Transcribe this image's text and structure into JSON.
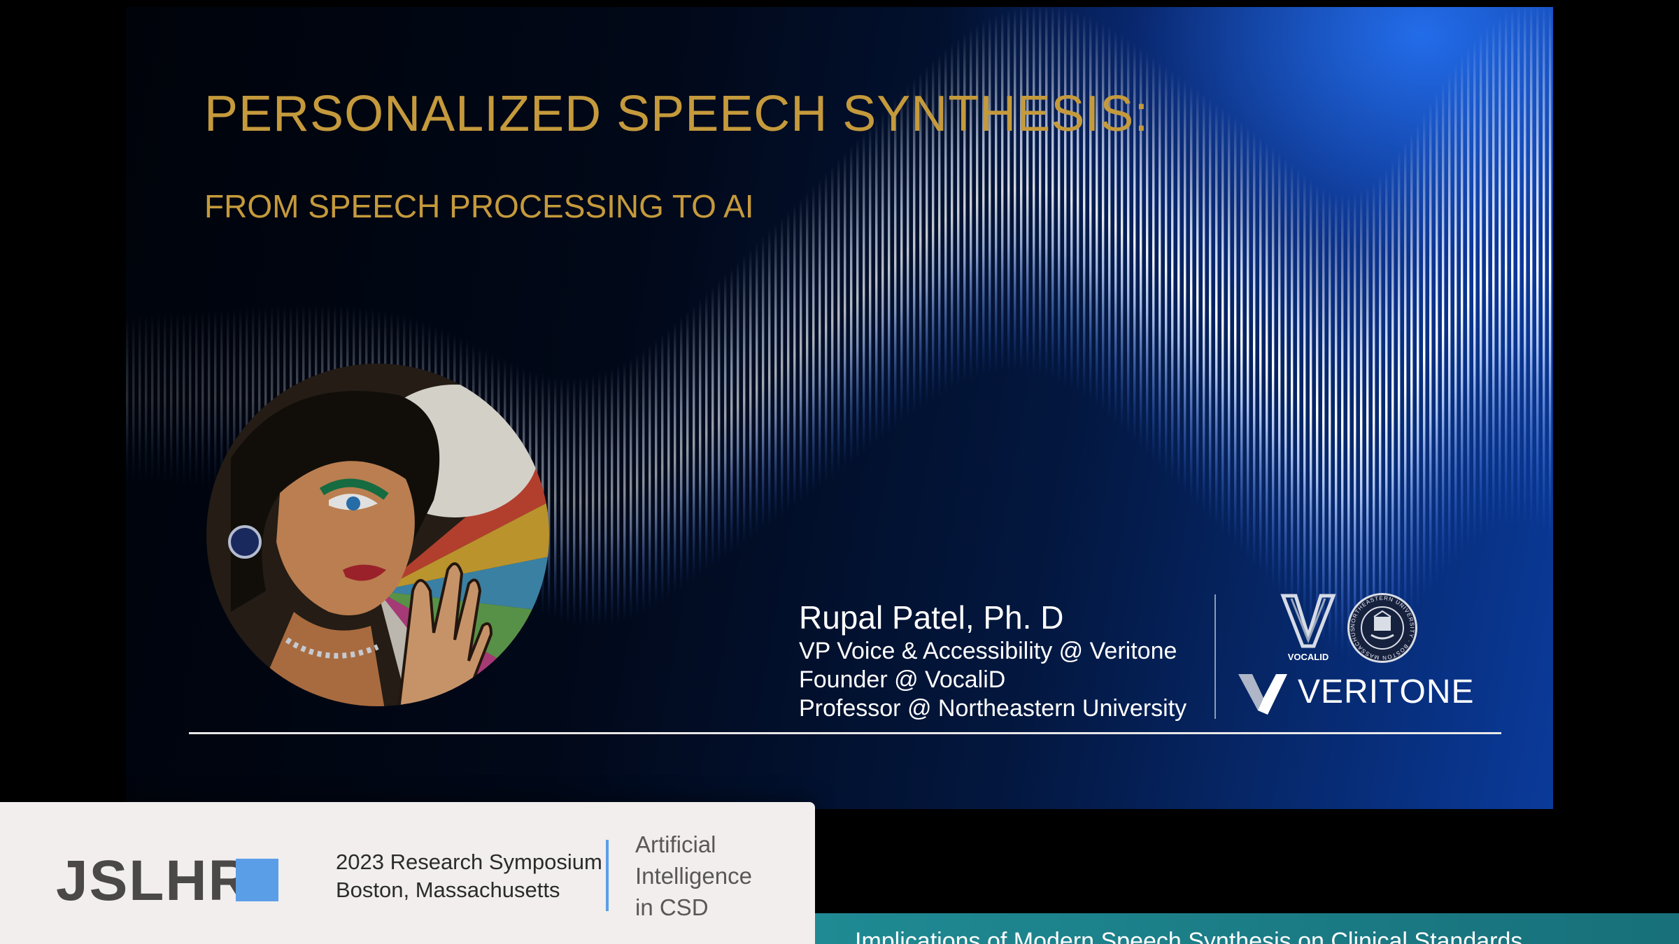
{
  "slide": {
    "title": "PERSONALIZED SPEECH SYNTHESIS:",
    "subtitle": "FROM SPEECH PROCESSING TO AI",
    "presenter": {
      "name": "Rupal Patel, Ph. D",
      "roles": [
        "VP Voice & Accessibility @ Veritone",
        "Founder @ VocaliD",
        "Professor @ Northeastern University"
      ]
    },
    "logos": {
      "vocalid_text": "VOCALID",
      "veritone_text": "VERITONE",
      "seal_text": "NORTHEASTERN UNIVERSITY · BOSTON MASSACHUSETTS"
    },
    "colors": {
      "title": "#c59a3c",
      "background_dark": "#010818",
      "background_glow": "#0a3a9a"
    }
  },
  "lower_third": {
    "brand": "JSLHR",
    "event_line_1": "2023 Research Symposium",
    "event_line_2": "Boston, Massachusetts",
    "topic_lines": [
      "Artificial",
      "Intelligence",
      "in CSD"
    ],
    "talk_title": "Implications of Modern Speech Synthesis on Clinical Standards",
    "colors": {
      "accent_blue": "#5b9ee8",
      "banner_teal": "#1f8a93",
      "card_bg": "#f1eeed"
    }
  }
}
